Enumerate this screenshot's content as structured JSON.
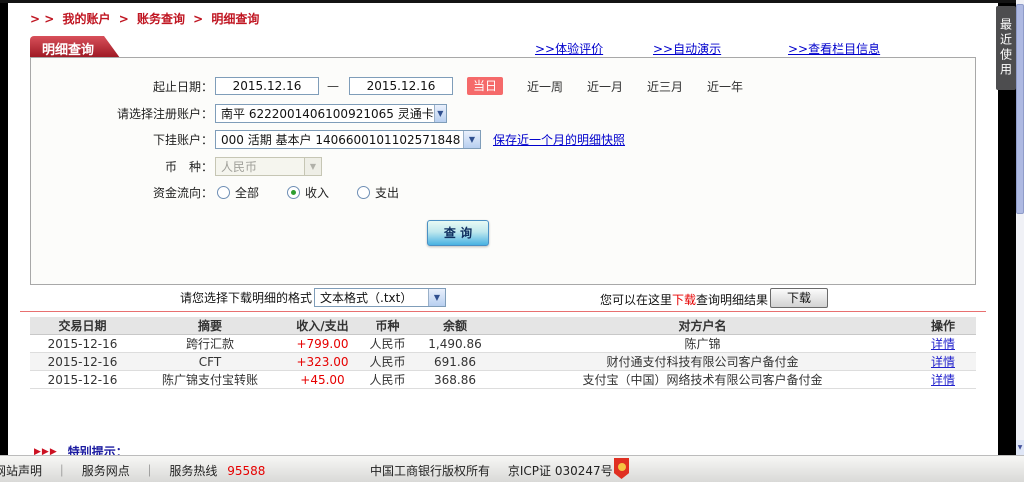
{
  "breadcrumb": {
    "arrows": "> >",
    "sep": ">",
    "item1": "我的账户",
    "item2": "账务查询",
    "item3": "明细查询"
  },
  "panel": {
    "tab_label": "明细查询",
    "links": {
      "experience": ">>体验评价",
      "demo": ">>自动演示",
      "column_info": ">>查看栏目信息"
    },
    "form": {
      "date_label": "起止日期：",
      "date_from": "2015.12.16",
      "date_to": "2015.12.16",
      "dash": "—",
      "today": "当日",
      "ranges": [
        "近一周",
        "近一月",
        "近三月",
        "近一年"
      ],
      "account_label": "请选择注册账户：",
      "account_value": "南平 6222001406100921065 灵通卡",
      "sub_account_label": "下挂账户：",
      "sub_account_value": "000 活期 基本户 1406600101102571848",
      "snapshot_link": "保存近一个月的明细快照",
      "currency_label": "币　种：",
      "currency_value": "人民币",
      "flow_label": "资金流向：",
      "flow_options": [
        "全部",
        "收入",
        "支出"
      ],
      "flow_selected": "收入",
      "query_button": "查 询"
    }
  },
  "download": {
    "format_label": "请您选择下载明细的格式",
    "format_value": "文本格式（.txt）",
    "hint_pre": "您可以在这里",
    "hint_red": "下载",
    "hint_post": "查询明细结果",
    "button": "下载"
  },
  "table": {
    "headers": [
      "交易日期",
      "摘要",
      "收入/支出",
      "币种",
      "余额",
      "对方户名",
      "操作"
    ],
    "rows": [
      {
        "date": "2015-12-16",
        "summary": "跨行汇款",
        "amount": "+799.00",
        "currency": "人民币",
        "balance": "1,490.86",
        "counterparty": "陈广锦",
        "action": "详情"
      },
      {
        "date": "2015-12-16",
        "summary": "CFT",
        "amount": "+323.00",
        "currency": "人民币",
        "balance": "691.86",
        "counterparty": "财付通支付科技有限公司客户备付金",
        "action": "详情"
      },
      {
        "date": "2015-12-16",
        "summary": "陈广锦支付宝转账",
        "amount": "+45.00",
        "currency": "人民币",
        "balance": "368.86",
        "counterparty": "支付宝（中国）网络技术有限公司客户备付金",
        "action": "详情"
      }
    ]
  },
  "notice": {
    "arrows": "▶▶▶",
    "label": "特别提示："
  },
  "footer": {
    "links": [
      "网站声明",
      "服务网点"
    ],
    "sep": "｜",
    "hotline_label": "服务热线",
    "hotline_number": "95588",
    "copyright": "中国工商银行版权所有",
    "icp": "京ICP证 030247号"
  },
  "side_tab": {
    "label": "最近使用"
  },
  "icons": {
    "dropdown_arrow": "▼",
    "scroll_down_arrow": "▼"
  },
  "colors": {
    "accent_red": "#c01622",
    "link_blue": "#0000cc",
    "amount_red": "#e60000",
    "today_button": "#f56a6a",
    "radio_selected_green": "#2f9e2f"
  }
}
